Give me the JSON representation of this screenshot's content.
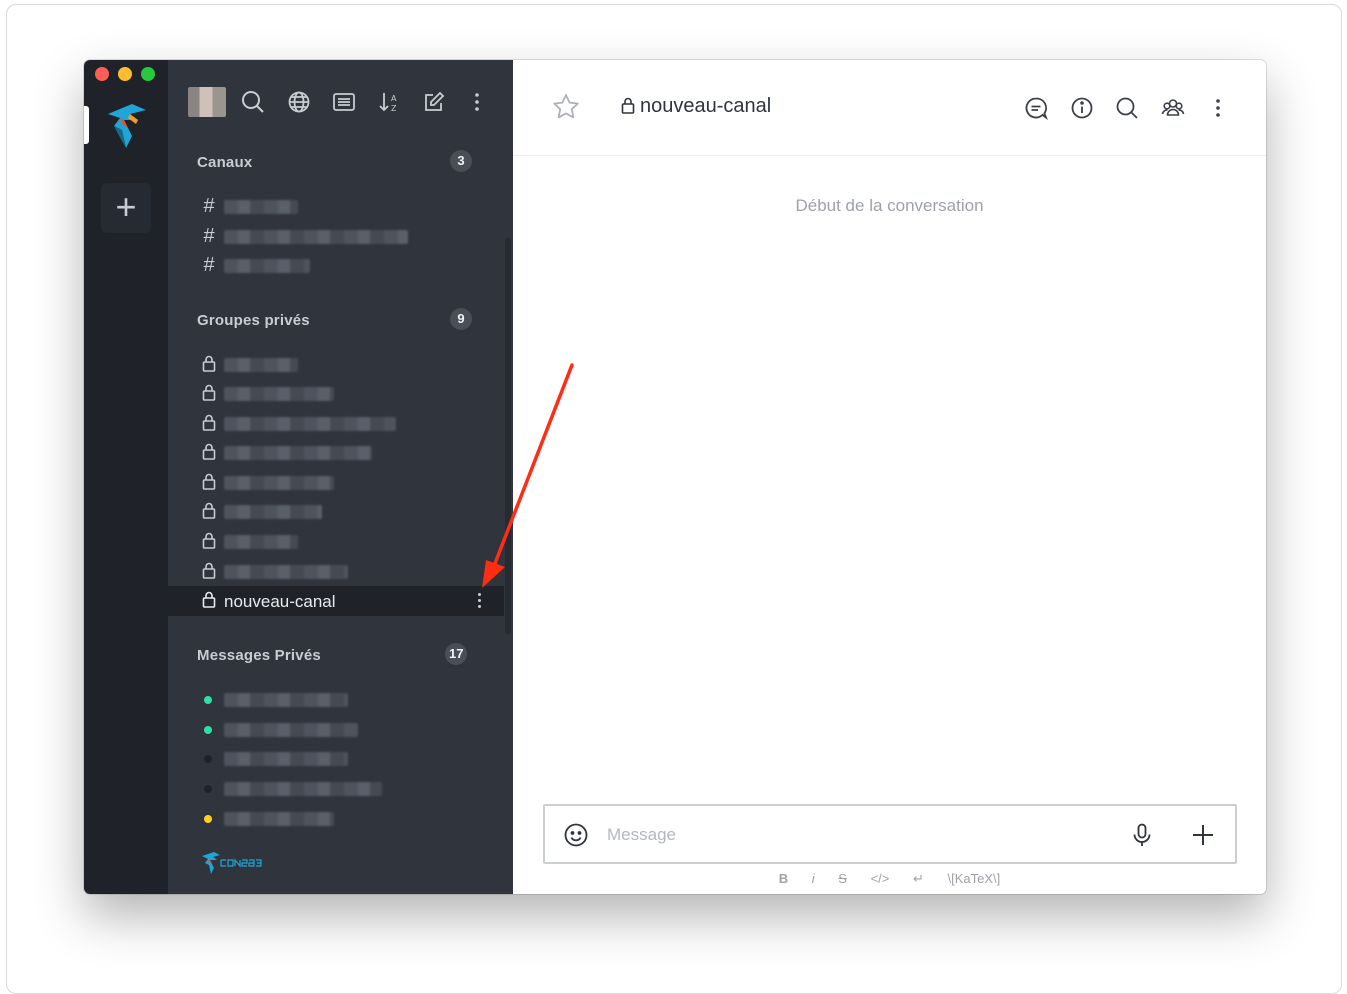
{
  "sidebar": {
    "sections": [
      {
        "title": "Canaux",
        "badge": "3"
      },
      {
        "title": "Groupes privés",
        "badge": "9"
      },
      {
        "title": "Messages Privés",
        "badge": "17"
      }
    ],
    "selected_room": "nouveau-canal"
  },
  "header": {
    "room_name": "nouveau-canal"
  },
  "main": {
    "start_text": "Début de la conversation"
  },
  "composer": {
    "placeholder": "Message"
  },
  "format_bar": {
    "bold": "B",
    "italic": "i",
    "strike": "S",
    "code": "</>",
    "newline": "↵",
    "katex": "\\[KaTeX\\]"
  },
  "colors": {
    "online": "#2de0a5",
    "away": "#ffd21f",
    "offline": "#1f2329",
    "annotation_arrow": "#ff2d14"
  }
}
